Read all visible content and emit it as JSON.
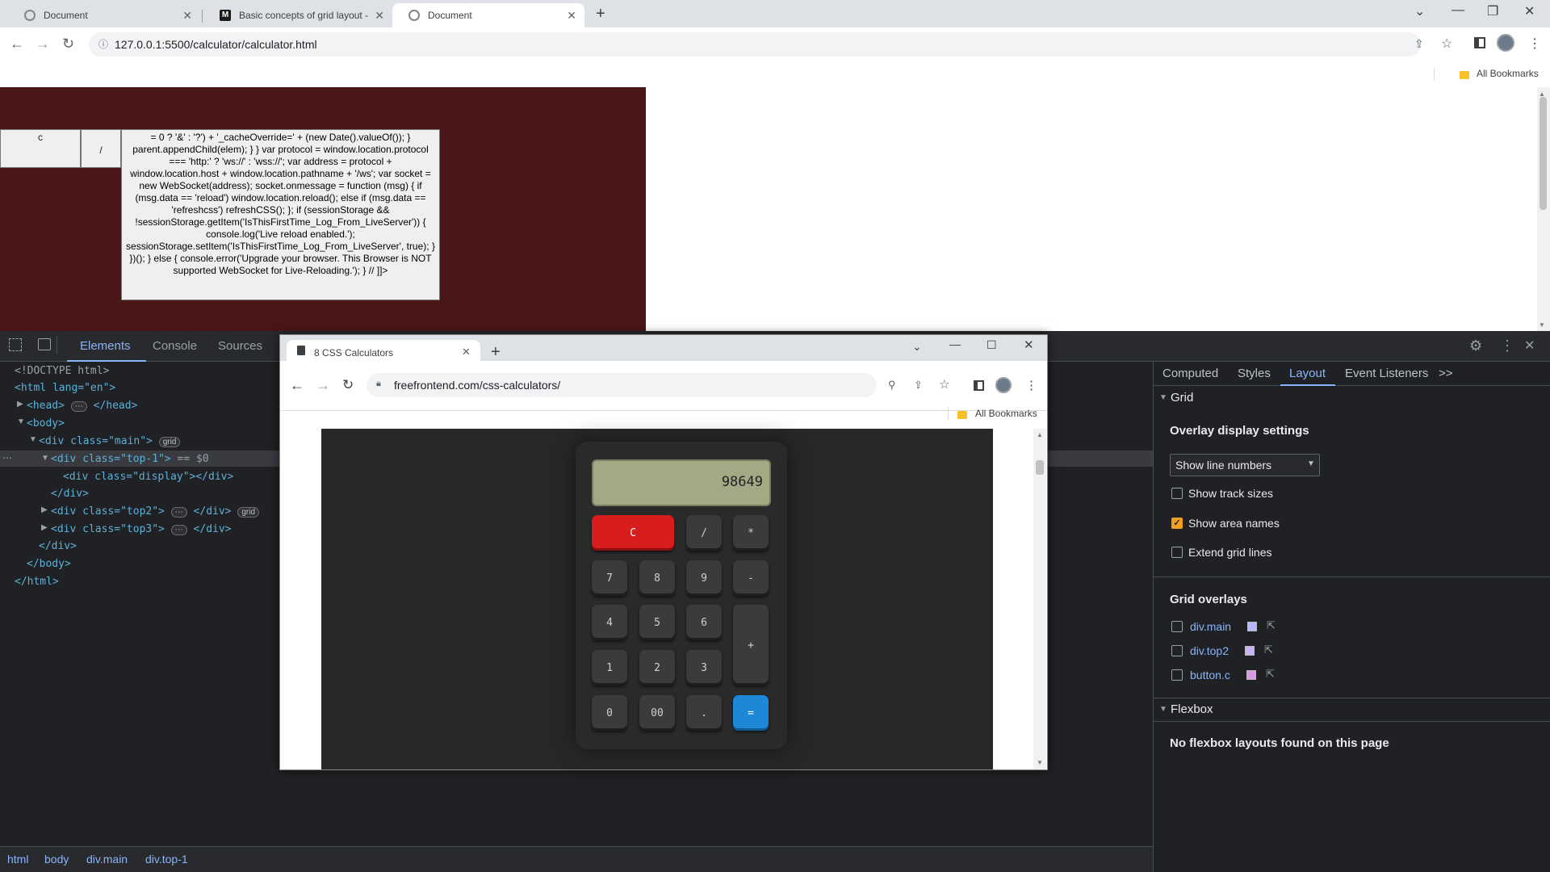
{
  "browser": {
    "tabs": [
      {
        "title": "Document"
      },
      {
        "title": "Basic concepts of grid layout - C"
      },
      {
        "title": "Document"
      }
    ],
    "url": "127.0.0.1:5500/calculator/calculator.html",
    "bookmarks_label": "All Bookmarks"
  },
  "page": {
    "cell_c": "c",
    "cell_div": "/",
    "script_text": "= 0 ? '&' : '?') + '_cacheOverride=' + (new Date().valueOf()); } parent.appendChild(elem); } } var protocol = window.location.protocol === 'http:' ? 'ws://' : 'wss://'; var address = protocol + window.location.host + window.location.pathname + '/ws'; var socket = new WebSocket(address); socket.onmessage = function (msg) { if (msg.data == 'reload') window.location.reload(); else if (msg.data == 'refreshcss') refreshCSS(); }; if (sessionStorage && !sessionStorage.getItem('IsThisFirstTime_Log_From_LiveServer')) { console.log('Live reload enabled.'); sessionStorage.setItem('IsThisFirstTime_Log_From_LiveServer', true); } })(); } else { console.error('Upgrade your browser. This Browser is NOT supported WebSocket for Live-Reloading.'); } // ]]>"
  },
  "devtools": {
    "tabs": [
      "Elements",
      "Console",
      "Sources"
    ],
    "dom": {
      "doctype": "<!DOCTYPE html>",
      "html_open": "<html lang=\"en\">",
      "head": "<head>",
      "head_close": "</head>",
      "body_open": "<body>",
      "main_open": "<div class=\"main\">",
      "top1_open": "<div class=\"top-1\">",
      "top1_suffix": "== $0",
      "display": "<div class=\"display\"></div>",
      "div_close": "</div>",
      "top2": "<div class=\"top2\">",
      "top3": "<div class=\"top3\">",
      "body_close": "</body>",
      "html_close": "</html>",
      "badge_grid": "grid",
      "ellipsis": "⋯"
    },
    "breadcrumbs": [
      "html",
      "body",
      "div.main",
      "div.top-1"
    ],
    "right_tabs": [
      "Computed",
      "Styles",
      "Layout",
      "Event Listeners"
    ],
    "more_tabs": ">>",
    "layout": {
      "grid_title": "Grid",
      "overlay_title": "Overlay display settings",
      "select_value": "Show line numbers",
      "options": [
        {
          "label": "Show track sizes",
          "checked": false
        },
        {
          "label": "Show area names",
          "checked": true
        },
        {
          "label": "Extend grid lines",
          "checked": false
        }
      ],
      "overlays_title": "Grid overlays",
      "overlays": [
        {
          "label": "div.main",
          "color": "#b6b8fb"
        },
        {
          "label": "div.top2",
          "color": "#c8b3f5"
        },
        {
          "label": "button.c",
          "color": "#d99ae6"
        }
      ],
      "flexbox_title": "Flexbox",
      "flexbox_msg": "No flexbox layouts found on this page"
    }
  },
  "popup": {
    "tab_title": "8 CSS Calculators",
    "url": "freefrontend.com/css-calculators/",
    "bookmarks_label": "All Bookmarks",
    "calculator": {
      "display": "98649",
      "keys": {
        "clear": "C",
        "divide": "/",
        "multiply": "*",
        "k7": "7",
        "k8": "8",
        "k9": "9",
        "minus": "-",
        "k4": "4",
        "k5": "5",
        "k6": "6",
        "plus": "+",
        "k1": "1",
        "k2": "2",
        "k3": "3",
        "k0": "0",
        "k00": "00",
        "dot": ".",
        "equals": "="
      }
    }
  }
}
